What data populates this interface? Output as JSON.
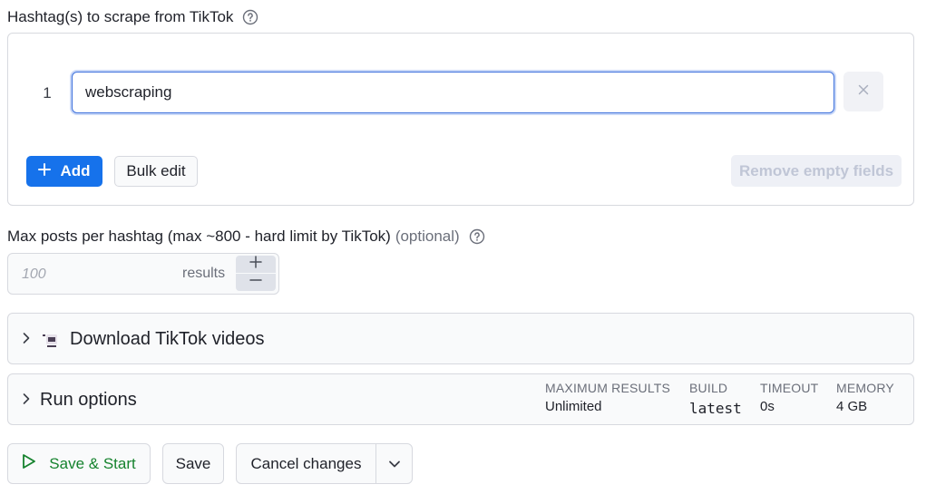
{
  "hashtags": {
    "label": "Hashtag(s) to scrape from TikTok",
    "rows": [
      {
        "index": "1",
        "value": "webscraping"
      }
    ],
    "add_label": "Add",
    "bulk_edit_label": "Bulk edit",
    "remove_empty_label": "Remove empty fields"
  },
  "max_posts": {
    "label": "Max posts per hashtag (max ~800 - hard limit by TikTok)",
    "optional_label": "(optional)",
    "placeholder": "100",
    "unit_label": "results"
  },
  "download_section": {
    "title": "Download TikTok videos"
  },
  "run_options": {
    "title": "Run options",
    "maximum_results": {
      "label": "MAXIMUM RESULTS",
      "value": "Unlimited"
    },
    "build": {
      "label": "BUILD",
      "value": "latest"
    },
    "timeout": {
      "label": "TIMEOUT",
      "value": "0s"
    },
    "memory": {
      "label": "MEMORY",
      "value": "4 GB"
    }
  },
  "footer": {
    "save_start_label": "Save & Start",
    "save_label": "Save",
    "cancel_label": "Cancel changes"
  },
  "colors": {
    "primary": "#1672eb",
    "success": "#16832e",
    "focus_border": "#3f72dd"
  },
  "icons": {
    "help": "question-circle-icon",
    "close": "close-x-icon",
    "plus": "plus-icon",
    "chevron_right": "chevron-right-icon",
    "video": "tiktok-video-icon",
    "play": "play-outline-icon",
    "chevron_down": "chevron-down-icon"
  }
}
